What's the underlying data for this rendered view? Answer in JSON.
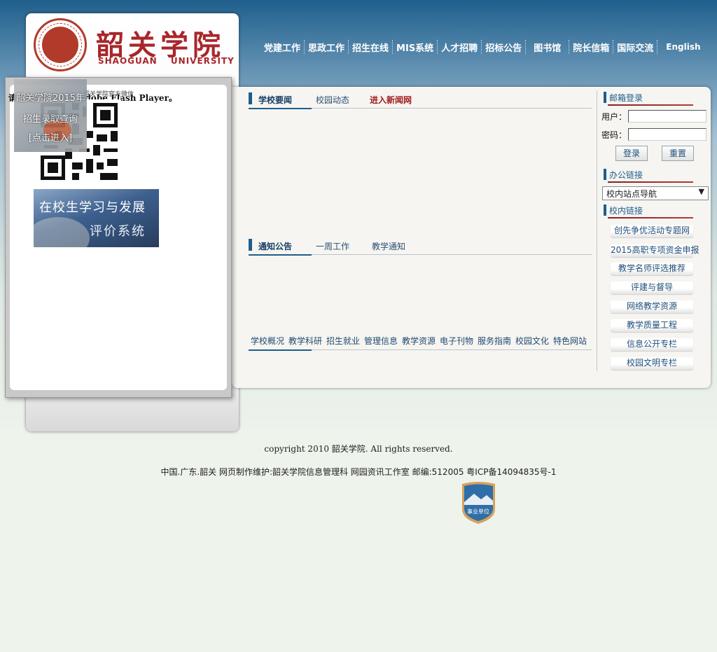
{
  "header": {
    "logo_cn": "韶关学院",
    "logo_en": "SHAOGUAN UNIVERSITY",
    "nav": [
      "党建工作",
      "思政工作",
      "招生在线",
      "MIS系统",
      "人才招聘",
      "招标公告",
      "图书馆",
      "院长信箱",
      "国际交流",
      "English"
    ]
  },
  "popup": {
    "flash_notice": "请安装最新版本的 Adobe Flash Player。",
    "qr_label": "韶关学院官方微信",
    "ad_lines": [
      "韶关学院2015年",
      "招生录取查询",
      "[点击进入]"
    ],
    "eval_banner": [
      "在校生学习与发展",
      "评价系统"
    ]
  },
  "news": {
    "tabs": [
      "学校要闻",
      "校园动态",
      "进入新闻网"
    ]
  },
  "notice": {
    "tabs": [
      "通知公告",
      "一周工作",
      "教学通知"
    ]
  },
  "quick_links": [
    "学校概况",
    "教学科研",
    "招生就业",
    "管理信息",
    "教学资源",
    "电子刊物",
    "服务指南",
    "校园文化",
    "特色网站"
  ],
  "mail_login": {
    "title": "邮箱登录",
    "user_label": "用户：",
    "pass_label": "密码：",
    "user_value": "",
    "pass_value": "",
    "login_btn": "登录",
    "reset_btn": "重置"
  },
  "office_links": {
    "title": "办公链接",
    "selected": "校内站点导航"
  },
  "campus_links": {
    "title": "校内链接",
    "items": [
      "创先争优活动专题网",
      "2015高职专项资金申报",
      "教学名师评选推荐",
      "评建与督导",
      "网络教学资源",
      "教学质量工程",
      "信息公开专栏",
      "校园文明专栏"
    ]
  },
  "footer": {
    "copyright": "copyright  2010 韶关学院. All  rights  reserved.",
    "info": "中国.广东.韶关  网页制作维护:韶关学院信息管理科  网园资讯工作室  邮编:512005  粤ICP备14094835号-1",
    "badge_text": "事业单位"
  },
  "colors": {
    "brand_red": "#a8262b",
    "nav_blue": "#1e5d8c",
    "link_blue": "#1f4f7a"
  }
}
